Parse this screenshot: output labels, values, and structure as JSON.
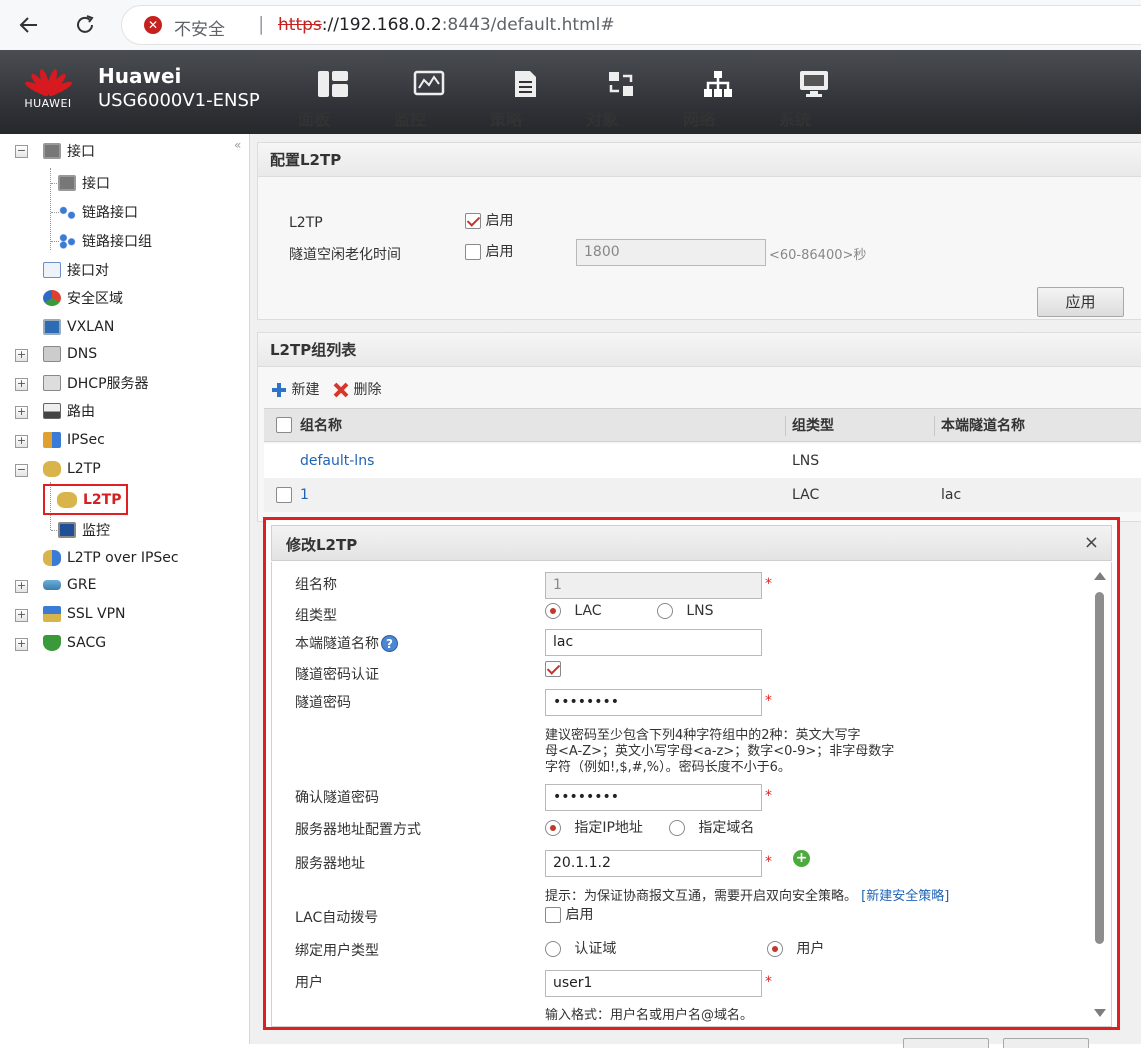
{
  "browser": {
    "insecure_label": "不安全",
    "url_protocol": "https",
    "url_host": "://192.168.0.2",
    "url_path": ":8443/default.html#"
  },
  "header": {
    "logo_text": "HUAWEI",
    "brand": "Huawei",
    "model": "USG6000V1-ENSP",
    "nav": [
      {
        "label": "面板",
        "icon": "dashboard-icon"
      },
      {
        "label": "监控",
        "icon": "monitor-icon"
      },
      {
        "label": "策略",
        "icon": "policy-icon"
      },
      {
        "label": "对象",
        "icon": "object-icon"
      },
      {
        "label": "网络",
        "icon": "network-icon"
      },
      {
        "label": "系统",
        "icon": "system-icon"
      }
    ],
    "active_nav": "网络"
  },
  "sidebar": {
    "collapse_glyph": "«",
    "items": [
      {
        "label": "接口",
        "icon": "interface-icon"
      },
      {
        "label": "接口",
        "icon": "interface-icon"
      },
      {
        "label": "链路接口",
        "icon": "link-interface-icon"
      },
      {
        "label": "链路接口组",
        "icon": "link-interface-group-icon"
      },
      {
        "label": "接口对",
        "icon": "interface-pair-icon"
      },
      {
        "label": "安全区域",
        "icon": "security-zone-icon"
      },
      {
        "label": "VXLAN",
        "icon": "vxlan-icon"
      },
      {
        "label": "DNS",
        "icon": "dns-icon"
      },
      {
        "label": "DHCP服务器",
        "icon": "dhcp-icon"
      },
      {
        "label": "路由",
        "icon": "route-icon"
      },
      {
        "label": "IPSec",
        "icon": "ipsec-icon"
      },
      {
        "label": "L2TP",
        "icon": "l2tp-icon"
      },
      {
        "label": "L2TP",
        "icon": "l2tp-icon"
      },
      {
        "label": "监控",
        "icon": "monitor-icon"
      },
      {
        "label": "L2TP over IPSec",
        "icon": "l2tp-ipsec-icon"
      },
      {
        "label": "GRE",
        "icon": "gre-icon"
      },
      {
        "label": "SSL VPN",
        "icon": "sslvpn-icon"
      },
      {
        "label": "SACG",
        "icon": "sacg-icon"
      }
    ]
  },
  "config_panel": {
    "title": "配置L2TP",
    "l2tp_label": "L2TP",
    "l2tp_enable_label": "启用",
    "l2tp_enabled": true,
    "idle_label": "隧道空闲老化时间",
    "idle_enable_label": "启用",
    "idle_enabled": false,
    "idle_value": "1800",
    "idle_range": "<60-86400>秒",
    "apply_label": "应用"
  },
  "group_panel": {
    "title": "L2TP组列表",
    "new_label": "新建",
    "delete_label": "删除",
    "columns": [
      "组名称",
      "组类型",
      "本端隧道名称"
    ],
    "rows": [
      {
        "name": "default-lns",
        "type": "LNS",
        "tunnel": ""
      },
      {
        "name": "1",
        "type": "LAC",
        "tunnel": "lac"
      }
    ]
  },
  "dialog": {
    "title": "修改L2TP",
    "close_glyph": "×",
    "group_name_label": "组名称",
    "group_name_value": "1",
    "group_type_label": "组类型",
    "group_type_options": [
      "LAC",
      "LNS"
    ],
    "group_type_selected": "LAC",
    "tunnel_name_label": "本端隧道名称",
    "tunnel_name_value": "lac",
    "tunnel_auth_label": "隧道密码认证",
    "tunnel_auth_checked": true,
    "tunnel_pwd_label": "隧道密码",
    "tunnel_pwd_value": "••••••••",
    "pwd_hint_1": "建议密码至少包含下列4种字符组中的2种：英文大写字",
    "pwd_hint_2": "母<A-Z>；英文小写字母<a-z>；数字<0-9>；非字母数字",
    "pwd_hint_3": "字符（例如!,$,#,%）。密码长度不小于6。",
    "confirm_pwd_label": "确认隧道密码",
    "confirm_pwd_value": "••••••••",
    "server_mode_label": "服务器地址配置方式",
    "server_mode_options": [
      "指定IP地址",
      "指定域名"
    ],
    "server_mode_selected": "指定IP地址",
    "server_addr_label": "服务器地址",
    "server_addr_value": "20.1.1.2",
    "server_hint": "提示：为保证协商报文互通，需要开启双向安全策略。",
    "server_hint_link": "[新建安全策略]",
    "lac_autodial_label": "LAC自动拨号",
    "lac_autodial_enable_label": "启用",
    "lac_autodial_checked": false,
    "bind_user_type_label": "绑定用户类型",
    "bind_user_type_options": [
      "认证域",
      "用户"
    ],
    "bind_user_type_selected": "用户",
    "user_label": "用户",
    "user_value": "user1",
    "user_hint": "输入格式：用户名或用户名@域名。",
    "required_mark": "*",
    "help_glyph": "?"
  },
  "colors": {
    "accent_red": "#e02020",
    "link_blue": "#1f63b5",
    "header_dark": "#2f3136"
  }
}
